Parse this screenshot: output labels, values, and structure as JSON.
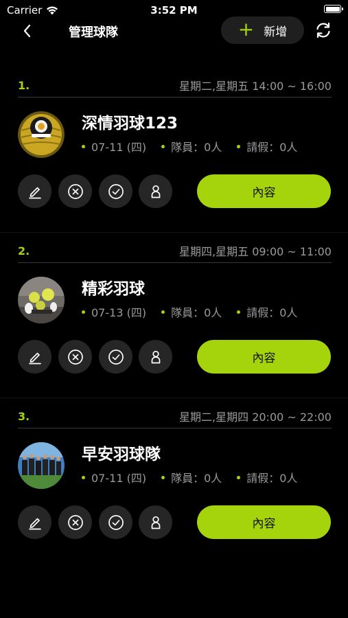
{
  "status_bar": {
    "carrier": "Carrier",
    "time": "3:52 PM"
  },
  "nav": {
    "title": "管理球隊",
    "add_label": "新增",
    "back_icon": "chevron-left-icon",
    "refresh_icon": "refresh-icon"
  },
  "colors": {
    "accent": "#a6d40c",
    "background": "#000000",
    "button_bg": "#262626",
    "muted_text": "#9a9a9a"
  },
  "teams": [
    {
      "index": "1.",
      "schedule": "星期二,星期五 14:00 ~ 16:00",
      "name": "深情羽球123",
      "date": "07-11 (四)",
      "members": "隊員：0人",
      "leave": "請假：0人",
      "detail_label": "內容"
    },
    {
      "index": "2.",
      "schedule": "星期四,星期五 09:00 ~ 11:00",
      "name": "精彩羽球",
      "date": "07-13 (四)",
      "members": "隊員：0人",
      "leave": "請假：0人",
      "detail_label": "內容"
    },
    {
      "index": "3.",
      "schedule": "星期二,星期四 20:00 ~ 22:00",
      "name": "早安羽球隊",
      "date": "07-11 (四)",
      "members": "隊員：0人",
      "leave": "請假：0人",
      "detail_label": "內容"
    }
  ],
  "action_icons": [
    "edit-icon",
    "cancel-circle-icon",
    "check-circle-icon",
    "member-icon"
  ]
}
